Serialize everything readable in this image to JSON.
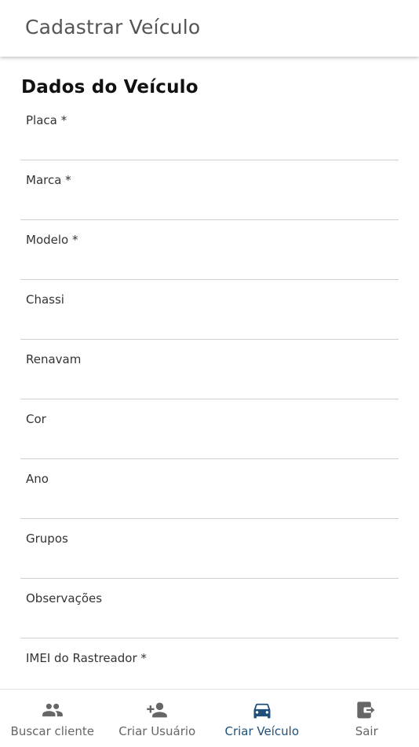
{
  "app_bar": {
    "title": "Cadastrar Veículo"
  },
  "form": {
    "section_title": "Dados do Veículo",
    "fields": [
      {
        "label": "Placa *",
        "value": ""
      },
      {
        "label": "Marca *",
        "value": ""
      },
      {
        "label": "Modelo *",
        "value": ""
      },
      {
        "label": "Chassi",
        "value": ""
      },
      {
        "label": "Renavam",
        "value": ""
      },
      {
        "label": "Cor",
        "value": ""
      },
      {
        "label": "Ano",
        "value": ""
      },
      {
        "label": "Grupos",
        "value": ""
      },
      {
        "label": "Observações",
        "value": ""
      },
      {
        "label": "IMEI do Rastreador *",
        "value": ""
      }
    ]
  },
  "bottom_nav": {
    "items": [
      {
        "label": "Buscar cliente",
        "icon": "group-icon"
      },
      {
        "label": "Criar Usuário",
        "icon": "person-add-icon"
      },
      {
        "label": "Criar Veículo",
        "icon": "car-icon"
      },
      {
        "label": "Sair",
        "icon": "exit-icon"
      }
    ],
    "active_index": 2,
    "active_color": "#1f4f7a",
    "inactive_color": "#666666"
  }
}
